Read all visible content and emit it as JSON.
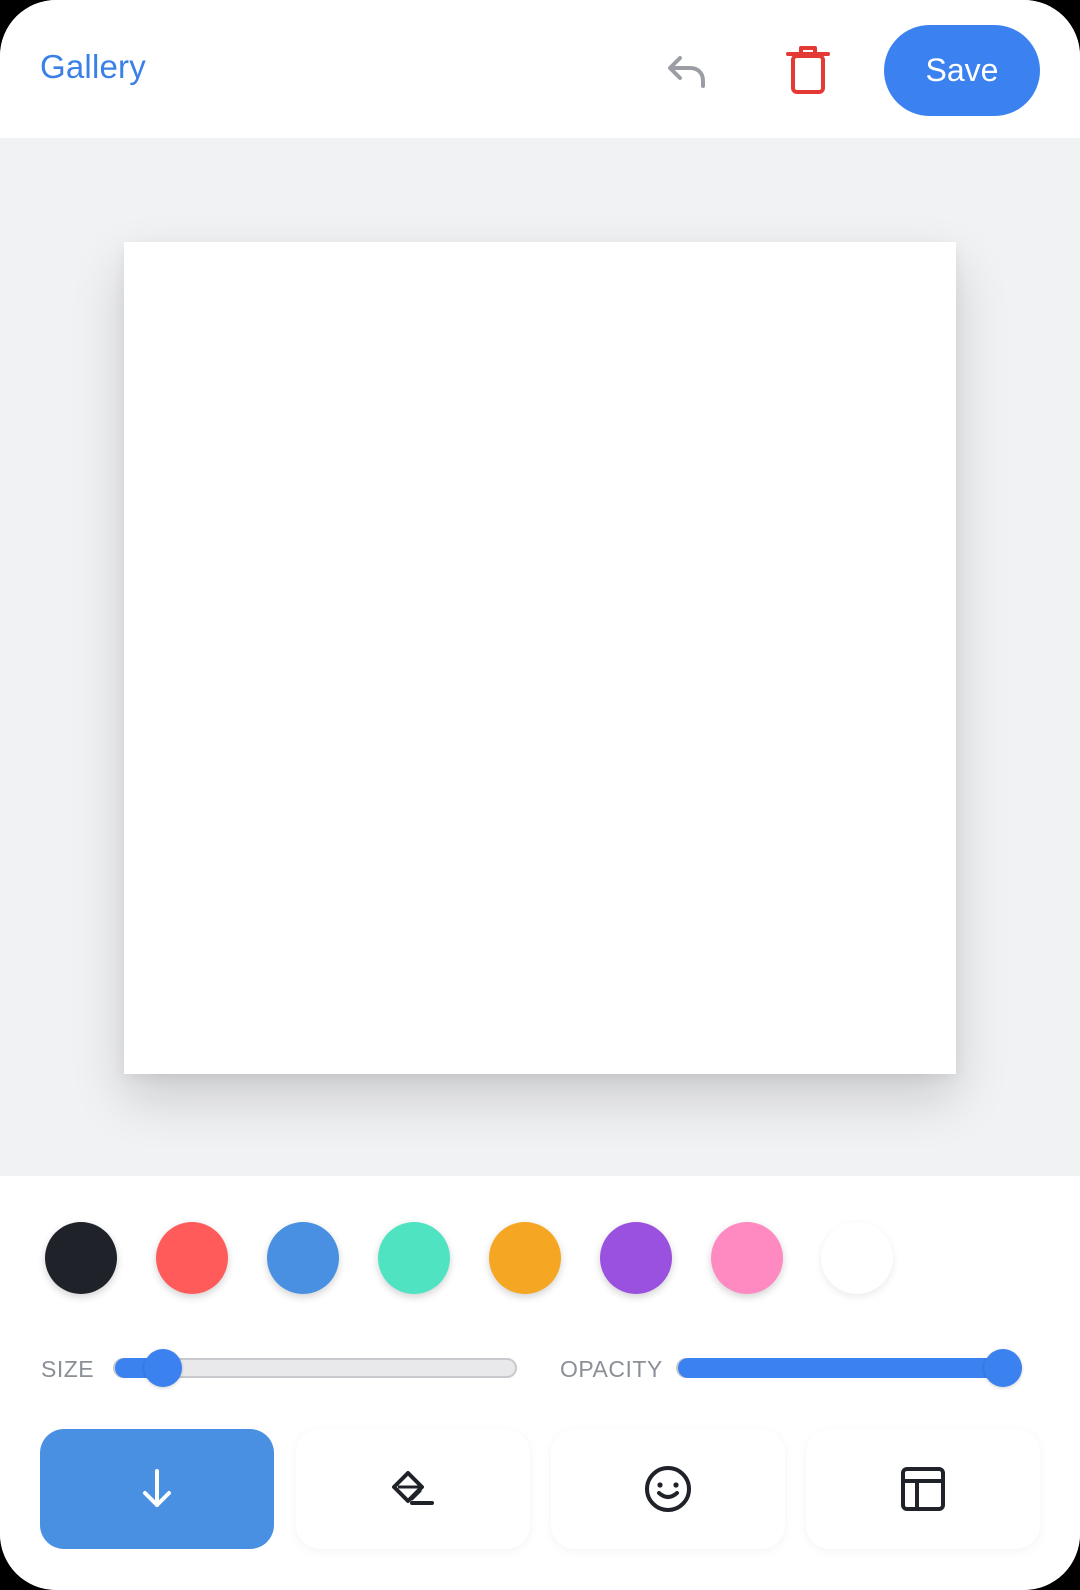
{
  "topbar": {
    "gallery_label": "Gallery",
    "undo_icon": "undo-icon",
    "trash_icon": "trash-icon",
    "save_label": "Save"
  },
  "palette": {
    "colors": [
      "#1f2329",
      "#ff5b5b",
      "#4a90e2",
      "#50e3c2",
      "#f5a623",
      "#9b51e0",
      "#ff8ac1",
      "#ffffff"
    ],
    "selected_color": "#1f2329"
  },
  "sliders": {
    "size": {
      "label": "SIZE",
      "value": 0.12
    },
    "opacity": {
      "label": "OPACITY",
      "value": 1.0
    }
  },
  "tools": [
    {
      "name": "download",
      "icon": "arrow-down-icon",
      "active": true
    },
    {
      "name": "fill",
      "icon": "paint-bucket-icon",
      "active": false
    },
    {
      "name": "stickers",
      "icon": "smiley-icon",
      "active": false
    },
    {
      "name": "templates",
      "icon": "layout-icon",
      "active": false
    }
  ],
  "colors": {
    "accent": "#3b82f0",
    "danger": "#e53935",
    "canvas_bg": "#f1f2f4"
  }
}
